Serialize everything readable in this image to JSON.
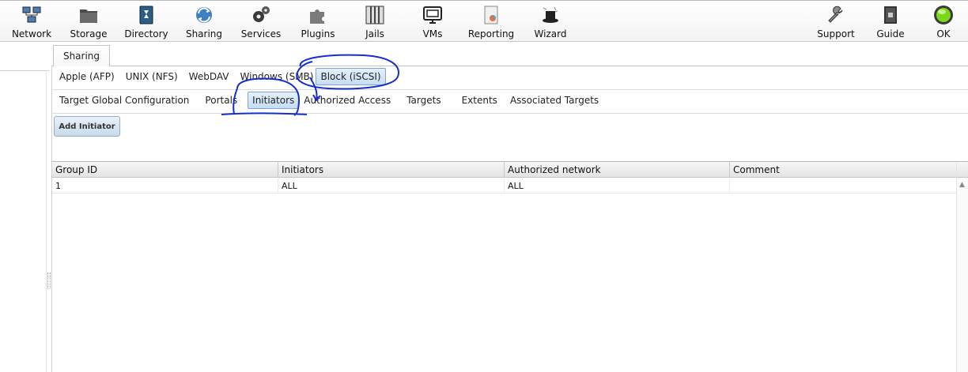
{
  "toolbar": {
    "items": [
      {
        "label": "Network",
        "icon": "network-icon"
      },
      {
        "label": "Storage",
        "icon": "storage-icon"
      },
      {
        "label": "Directory",
        "icon": "directory-icon"
      },
      {
        "label": "Sharing",
        "icon": "sharing-icon"
      },
      {
        "label": "Services",
        "icon": "services-icon"
      },
      {
        "label": "Plugins",
        "icon": "plugins-icon"
      },
      {
        "label": "Jails",
        "icon": "jails-icon"
      },
      {
        "label": "VMs",
        "icon": "vms-icon"
      },
      {
        "label": "Reporting",
        "icon": "reporting-icon"
      },
      {
        "label": "Wizard",
        "icon": "wizard-icon"
      }
    ],
    "right_items": [
      {
        "label": "Support",
        "icon": "support-icon"
      },
      {
        "label": "Guide",
        "icon": "guide-icon"
      },
      {
        "label": "OK",
        "icon": "ok-status-icon"
      }
    ]
  },
  "main": {
    "tab": "Sharing",
    "share_tabs": [
      "Apple (AFP)",
      "UNIX (NFS)",
      "WebDAV",
      "Windows (SMB)",
      "Block (iSCSI)"
    ],
    "share_tabs_active": "Block (iSCSI)",
    "iscsi_tabs": [
      "Target Global Configuration",
      "Portals",
      "Initiators",
      "Authorized Access",
      "Targets",
      "Extents",
      "Associated Targets"
    ],
    "iscsi_tabs_active": "Initiators",
    "add_button": "Add Initiator",
    "grid": {
      "columns": [
        "Group ID",
        "Initiators",
        "Authorized network",
        "Comment"
      ],
      "rows": [
        [
          "1",
          "ALL",
          "ALL",
          ""
        ]
      ]
    }
  },
  "colors": {
    "active_tab_bg": "#c6ddf3",
    "annotation_ink": "#1530c8",
    "ok_status": "#7cd61c"
  }
}
